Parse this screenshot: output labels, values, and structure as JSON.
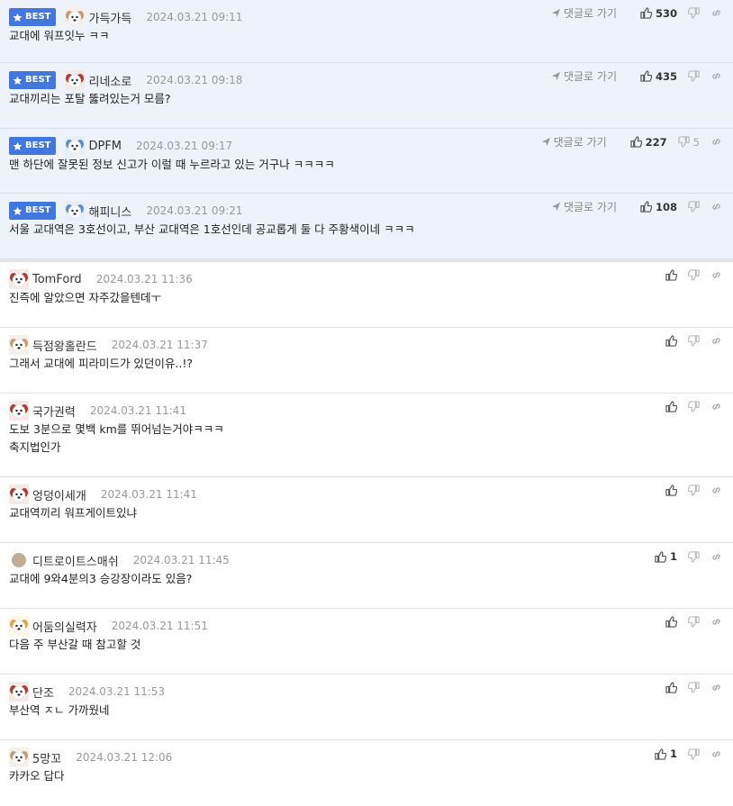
{
  "best_label": "BEST",
  "goto_label": "댓글로 가기",
  "best_comments": [
    {
      "nick": "가득가득",
      "date": "2024.03.21 09:11",
      "body": [
        "교대에 워프잇누 ㅋㅋ"
      ],
      "up": "530",
      "down": "",
      "avatar": "puppy-plain"
    },
    {
      "nick": "리네소로",
      "date": "2024.03.21 09:18",
      "body": [
        "교대끼리는 포탈 뚫려있는거 모름?"
      ],
      "up": "435",
      "down": "",
      "avatar": "puppy-red"
    },
    {
      "nick": "DPFM",
      "date": "2024.03.21 09:17",
      "body": [
        "맨 하단에 잘못된 정보 신고가 이럴 때 누르라고 있는 거구나 ㅋㅋㅋㅋ"
      ],
      "up": "227",
      "down": "5",
      "avatar": "puppy-blue"
    },
    {
      "nick": "해피니스",
      "date": "2024.03.21 09:21",
      "body": [
        "서울 교대역은 3호선이고, 부산 교대역은 1호선인데 공교롭게 둘 다 주황색이네 ㅋㅋㅋ"
      ],
      "up": "108",
      "down": "",
      "avatar": "puppy-blue"
    }
  ],
  "comments": [
    {
      "nick": "TomFord",
      "date": "2024.03.21 11:36",
      "body": [
        "진즉에 알았으면 자주갔을텐데ㅜ"
      ],
      "up": "",
      "avatar": "puppy-red"
    },
    {
      "nick": "득점왕홀란드",
      "date": "2024.03.21 11:37",
      "body": [
        "그래서 교대에 피라미드가 있던이유..!?"
      ],
      "up": "",
      "avatar": "puppy-plain"
    },
    {
      "nick": "국가권력",
      "date": "2024.03.21 11:41",
      "body": [
        "도보 3분으로 몇백 km를 뛰어넘는거야ㅋㅋㅋ",
        "축지법인가"
      ],
      "up": "",
      "avatar": "puppy-red"
    },
    {
      "nick": "엉덩이세개",
      "date": "2024.03.21 11:41",
      "body": [
        "교대역끼리 워프게이트있냐"
      ],
      "up": "",
      "avatar": "puppy-red"
    },
    {
      "nick": "디트로이트스매쉬",
      "date": "2024.03.21 11:45",
      "body": [
        "교대에 9와4분의3 승강장이라도 있음?"
      ],
      "up": "1",
      "avatar": "dot"
    },
    {
      "nick": "어둠의실력자",
      "date": "2024.03.21 11:51",
      "body": [
        "다음 주 부산갈 때 참고할 것"
      ],
      "up": "",
      "avatar": "fox"
    },
    {
      "nick": "단조",
      "date": "2024.03.21 11:53",
      "body": [
        "부산역 ㅈㄴ 가까웠네"
      ],
      "up": "",
      "avatar": "puppy-red"
    },
    {
      "nick": "5망꼬",
      "date": "2024.03.21 12:06",
      "body": [
        "카카오 답다"
      ],
      "up": "1",
      "avatar": "puppy-plain"
    }
  ]
}
